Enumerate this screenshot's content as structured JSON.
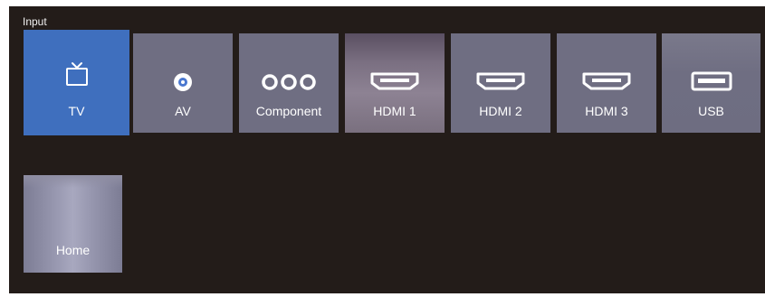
{
  "header": {
    "title": "Input"
  },
  "sources": [
    {
      "label": "TV",
      "icon": "tv-icon",
      "selected": true
    },
    {
      "label": "AV",
      "icon": "av-jack-icon",
      "selected": false
    },
    {
      "label": "Component",
      "icon": "component-jacks-icon",
      "selected": false
    },
    {
      "label": "HDMI 1",
      "icon": "hdmi-port-icon",
      "selected": false
    },
    {
      "label": "HDMI 2",
      "icon": "hdmi-port-icon",
      "selected": false
    },
    {
      "label": "HDMI 3",
      "icon": "hdmi-port-icon",
      "selected": false
    },
    {
      "label": "USB",
      "icon": "usb-port-icon",
      "selected": false
    }
  ],
  "home": {
    "label": "Home"
  },
  "colors": {
    "background": "#231c19",
    "tile": "#6f6e82",
    "selected_tile": "#3f6fbe",
    "text": "#ffffff"
  }
}
